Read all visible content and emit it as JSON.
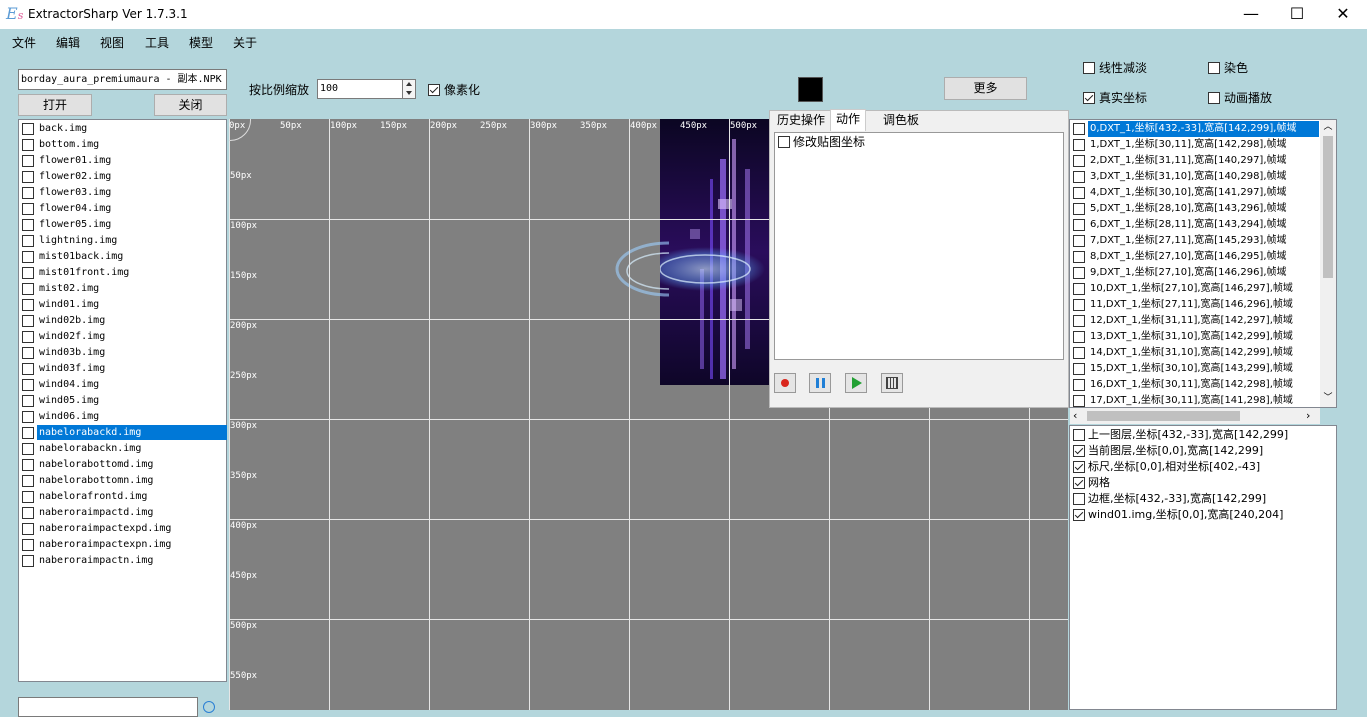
{
  "window": {
    "title": "ExtractorSharp Ver 1.7.3.1",
    "logo": "E",
    "logo_sub": "s",
    "minimize": "—",
    "maximize": "☐",
    "close": "✕"
  },
  "menu": [
    "文件",
    "编辑",
    "视图",
    "工具",
    "模型",
    "关于"
  ],
  "left": {
    "npk_path": "borday_aura_premiumaura - 副本.NPK",
    "open_button": "打开",
    "close_button": "关闭",
    "files": [
      {
        "name": "back.img",
        "checked": false,
        "selected": false
      },
      {
        "name": "bottom.img",
        "checked": false,
        "selected": false
      },
      {
        "name": "flower01.img",
        "checked": false,
        "selected": false
      },
      {
        "name": "flower02.img",
        "checked": false,
        "selected": false
      },
      {
        "name": "flower03.img",
        "checked": false,
        "selected": false
      },
      {
        "name": "flower04.img",
        "checked": false,
        "selected": false
      },
      {
        "name": "flower05.img",
        "checked": false,
        "selected": false
      },
      {
        "name": "lightning.img",
        "checked": false,
        "selected": false
      },
      {
        "name": "mist01back.img",
        "checked": false,
        "selected": false
      },
      {
        "name": "mist01front.img",
        "checked": false,
        "selected": false
      },
      {
        "name": "mist02.img",
        "checked": false,
        "selected": false
      },
      {
        "name": "wind01.img",
        "checked": false,
        "selected": false
      },
      {
        "name": "wind02b.img",
        "checked": false,
        "selected": false
      },
      {
        "name": "wind02f.img",
        "checked": false,
        "selected": false
      },
      {
        "name": "wind03b.img",
        "checked": false,
        "selected": false
      },
      {
        "name": "wind03f.img",
        "checked": false,
        "selected": false
      },
      {
        "name": "wind04.img",
        "checked": false,
        "selected": false
      },
      {
        "name": "wind05.img",
        "checked": false,
        "selected": false
      },
      {
        "name": "wind06.img",
        "checked": false,
        "selected": false
      },
      {
        "name": "nabelorabackd.img",
        "checked": false,
        "selected": true
      },
      {
        "name": "nabelorabackn.img",
        "checked": false,
        "selected": false
      },
      {
        "name": "nabelorabottomd.img",
        "checked": false,
        "selected": false
      },
      {
        "name": "nabelorabottomn.img",
        "checked": false,
        "selected": false
      },
      {
        "name": "nabelorafrontd.img",
        "checked": false,
        "selected": false
      },
      {
        "name": "naberoraimpactd.img",
        "checked": false,
        "selected": false
      },
      {
        "name": "naberoraimpactexpd.img",
        "checked": false,
        "selected": false
      },
      {
        "name": "naberoraimpactexpn.img",
        "checked": false,
        "selected": false
      },
      {
        "name": "naberoraimpactn.img",
        "checked": false,
        "selected": false
      }
    ],
    "search_value": ""
  },
  "toolbar": {
    "scale_label": "按比例缩放",
    "scale_value": "100",
    "pixelate_label": "像素化",
    "pixelate_checked": true,
    "color_swatch": "#000000",
    "more_button": "更多"
  },
  "options": {
    "linear_dodge": {
      "label": "线性减淡",
      "checked": false
    },
    "dye": {
      "label": "染色",
      "checked": false
    },
    "real_coords": {
      "label": "真实坐标",
      "checked": true
    },
    "animation": {
      "label": "动画播放",
      "checked": false
    }
  },
  "canvas": {
    "x_ruler": [
      "0px",
      "50px",
      "100px",
      "150px",
      "200px",
      "250px",
      "300px",
      "350px",
      "400px",
      "450px",
      "500px"
    ],
    "y_ruler": [
      "50px",
      "100px",
      "150px",
      "200px",
      "250px",
      "300px",
      "350px",
      "400px",
      "450px",
      "500px",
      "550px"
    ]
  },
  "tabs": {
    "items": [
      "历史操作",
      "动作",
      "调色板"
    ],
    "active": "动作",
    "action_item": "修改贴图坐标",
    "record_icon": "record-icon",
    "pause_icon": "pause-icon",
    "play_icon": "play-icon",
    "list_icon": "batch-icon"
  },
  "frames": [
    "0,DXT_1,坐标[432,-33],宽高[142,299],帧域",
    "1,DXT_1,坐标[30,11],宽高[142,298],帧域",
    "2,DXT_1,坐标[31,11],宽高[140,297],帧域",
    "3,DXT_1,坐标[31,10],宽高[140,298],帧域",
    "4,DXT_1,坐标[30,10],宽高[141,297],帧域",
    "5,DXT_1,坐标[28,10],宽高[143,296],帧域",
    "6,DXT_1,坐标[28,11],宽高[143,294],帧域",
    "7,DXT_1,坐标[27,11],宽高[145,293],帧域",
    "8,DXT_1,坐标[27,10],宽高[146,295],帧域",
    "9,DXT_1,坐标[27,10],宽高[146,296],帧域",
    "10,DXT_1,坐标[27,10],宽高[146,297],帧域",
    "11,DXT_1,坐标[27,11],宽高[146,296],帧域",
    "12,DXT_1,坐标[31,11],宽高[142,297],帧域",
    "13,DXT_1,坐标[31,10],宽高[142,299],帧域",
    "14,DXT_1,坐标[31,10],宽高[142,299],帧域",
    "15,DXT_1,坐标[30,10],宽高[143,299],帧域",
    "16,DXT_1,坐标[30,11],宽高[142,298],帧域",
    "17,DXT_1,坐标[30,11],宽高[141,298],帧域"
  ],
  "layers": [
    {
      "label": "上一图层,坐标[432,-33],宽高[142,299]",
      "checked": false
    },
    {
      "label": "当前图层,坐标[0,0],宽高[142,299]",
      "checked": true
    },
    {
      "label": "标尺,坐标[0,0],相对坐标[402,-43]",
      "checked": true
    },
    {
      "label": "网格",
      "checked": true
    },
    {
      "label": "边框,坐标[432,-33],宽高[142,299]",
      "checked": false
    },
    {
      "label": "wind01.img,坐标[0,0],宽高[240,204]",
      "checked": true
    }
  ]
}
